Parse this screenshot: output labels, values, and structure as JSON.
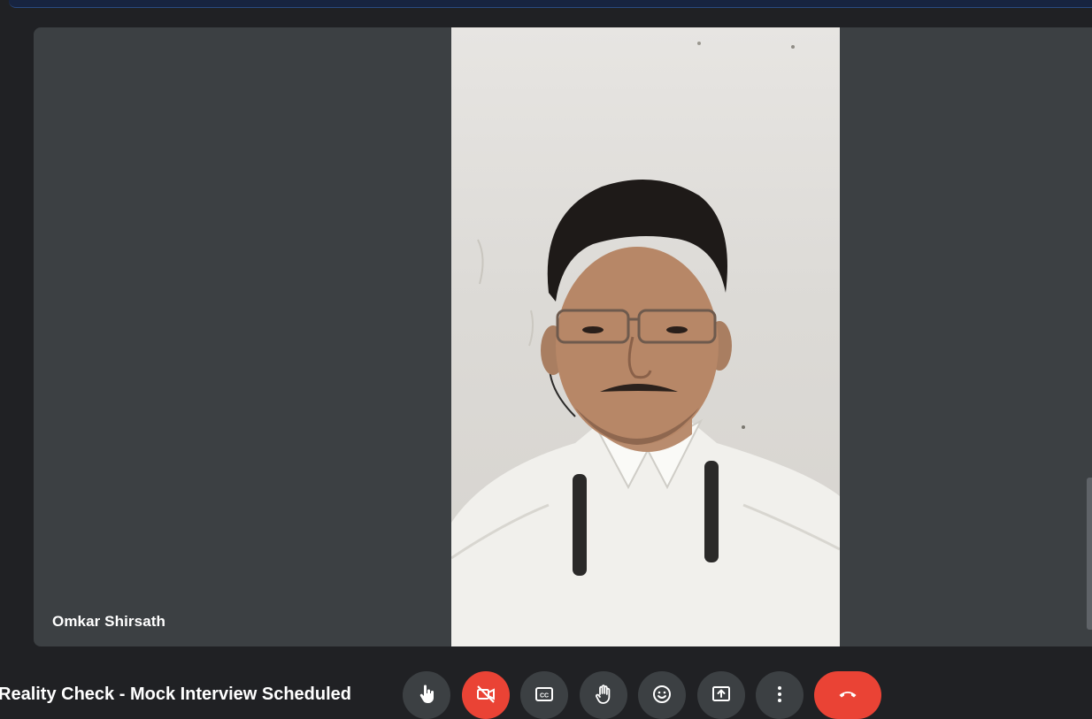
{
  "participant": {
    "name": "Omkar Shirsath"
  },
  "meeting": {
    "title": "Reality Check - Mock Interview Scheduled"
  },
  "controls": [
    {
      "id": "mic",
      "icon": "hand-pointer-icon"
    },
    {
      "id": "camera",
      "icon": "camera-off-icon",
      "state": "off"
    },
    {
      "id": "captions",
      "icon": "captions-icon"
    },
    {
      "id": "raise-hand",
      "icon": "raise-hand-icon"
    },
    {
      "id": "reactions",
      "icon": "emoji-icon"
    },
    {
      "id": "present",
      "icon": "present-screen-icon"
    },
    {
      "id": "more",
      "icon": "more-vert-icon"
    },
    {
      "id": "leave",
      "icon": "end-call-icon"
    }
  ],
  "colors": {
    "background": "#202124",
    "tile": "#3c4043",
    "danger": "#ea4335",
    "text": "#ffffff"
  }
}
